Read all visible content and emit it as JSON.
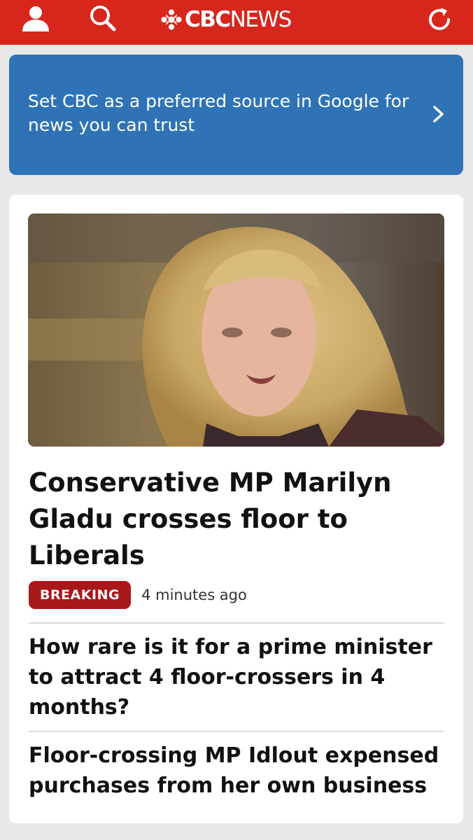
{
  "header": {
    "brand_bold": "CBC",
    "brand_light": "NEWS",
    "icons": [
      "profile-icon",
      "search-icon",
      "cbc-gem-icon",
      "refresh-icon"
    ],
    "accent_color": "#d7261c"
  },
  "promo": {
    "text": "Set CBC as a preferred source in Google for news you can trust",
    "color": "#2f73b6"
  },
  "top_story": {
    "headline": "Conservative MP Marilyn Gladu crosses floor to Liberals",
    "badge": "BREAKING",
    "timestamp": "4 minutes ago",
    "badge_color": "#a8171a"
  },
  "related": [
    {
      "headline": "How rare is it for a prime minister to attract 4 floor-crossers in 4 months?"
    },
    {
      "headline": "Floor-crossing MP Idlout expensed purchases from her own business"
    }
  ]
}
